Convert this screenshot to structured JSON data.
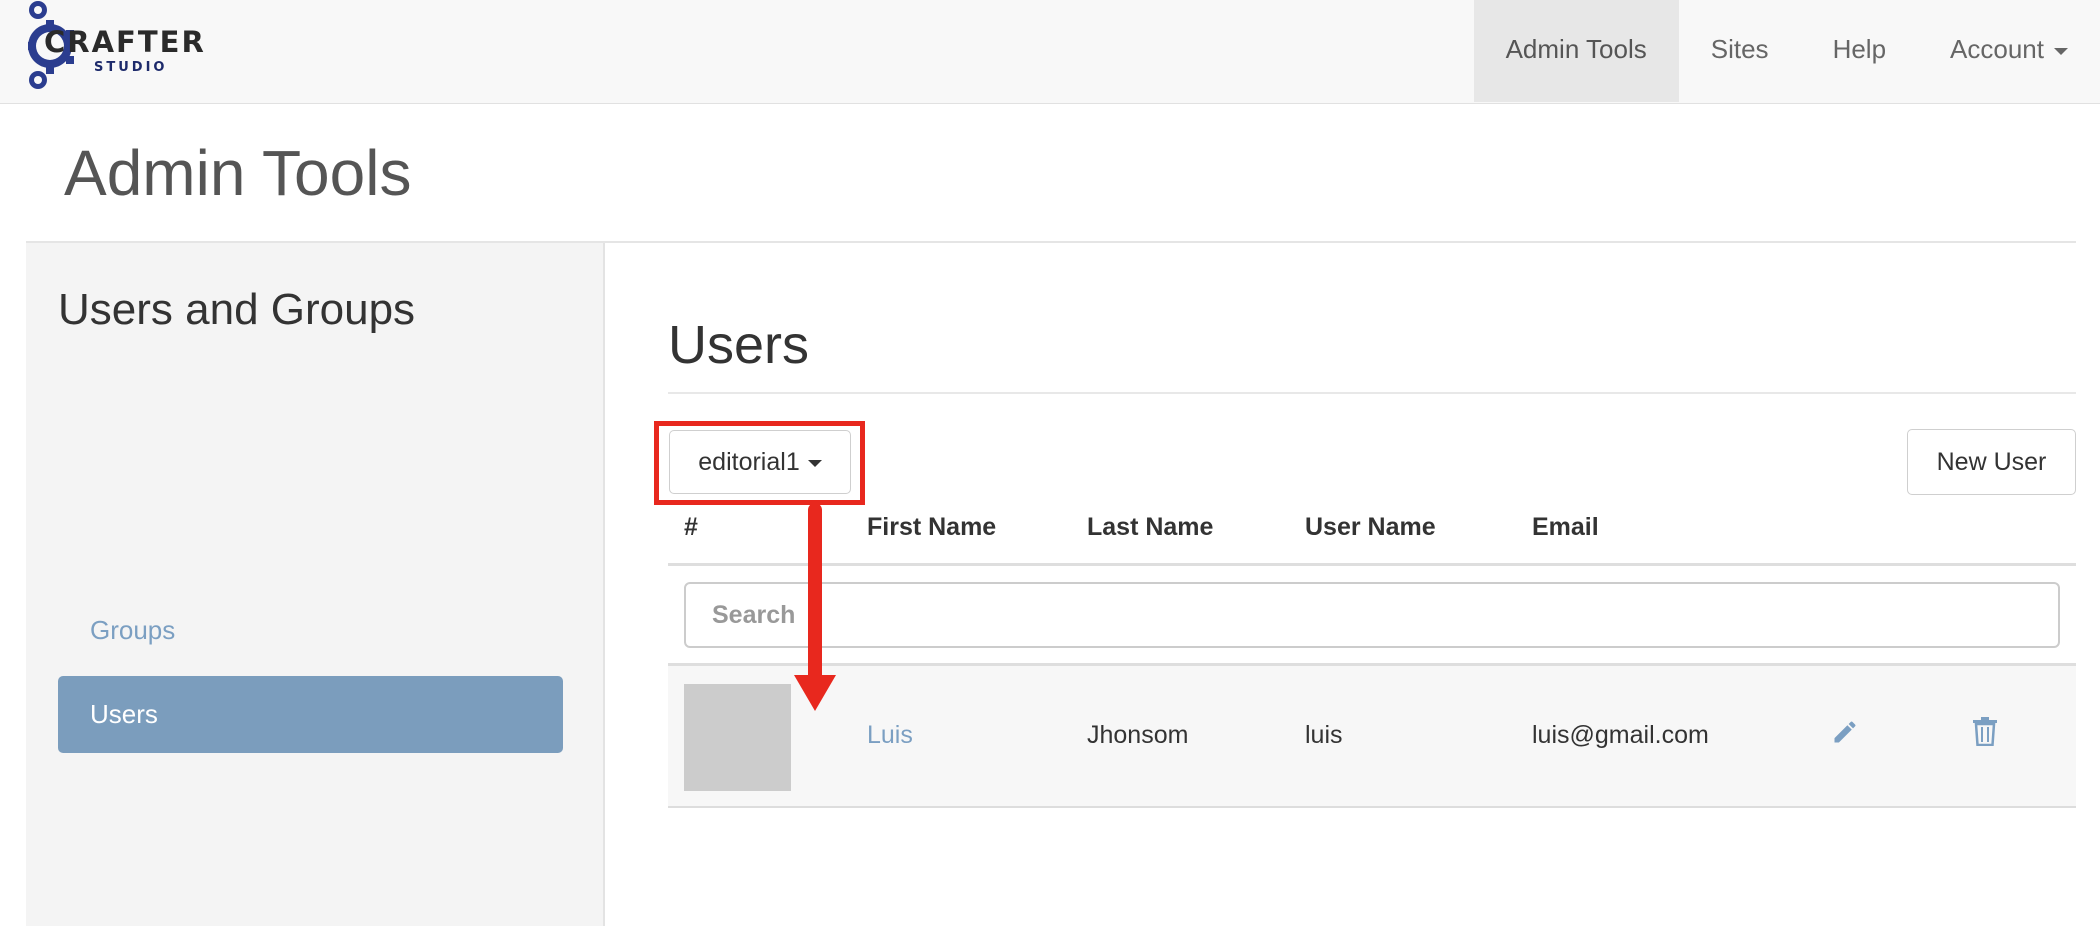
{
  "brand": {
    "word1": "CRAFTER",
    "word2": "STUDIO"
  },
  "nav": {
    "admin_tools": "Admin Tools",
    "sites": "Sites",
    "help": "Help",
    "account": "Account"
  },
  "page_title": "Admin Tools",
  "sidebar": {
    "heading": "Users and Groups",
    "items": [
      {
        "label": "Groups",
        "active": false
      },
      {
        "label": "Users",
        "active": true
      }
    ]
  },
  "main": {
    "title": "Users",
    "site_select": "editorial1",
    "new_user": "New User",
    "columns": [
      "#",
      "First Name",
      "Last Name",
      "User Name",
      "Email"
    ],
    "search_placeholder": "Search",
    "rows": [
      {
        "first_name": "Luis",
        "last_name": "Jhonsom",
        "user_name": "luis",
        "email": "luis@gmail.com"
      }
    ]
  },
  "icons": [
    "gear-logo-icon",
    "chevron-down-icon",
    "pencil-icon",
    "trash-icon",
    "annotation-arrow"
  ],
  "colors": {
    "accent": "#7b9dbd",
    "link": "#7b9fc2",
    "annotation": "#e8281e"
  }
}
